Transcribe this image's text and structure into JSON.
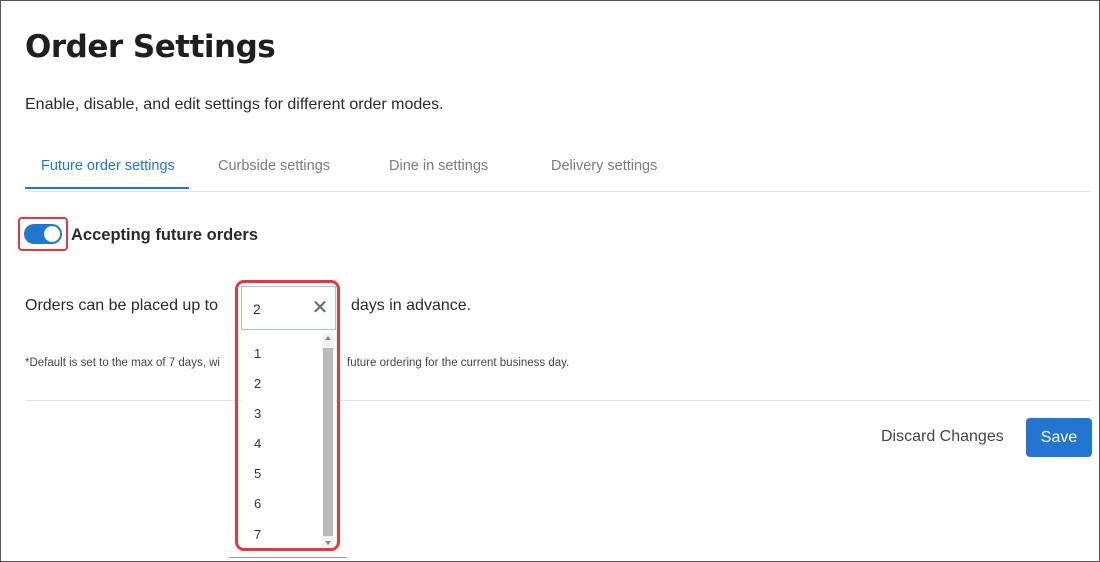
{
  "page": {
    "title": "Order Settings",
    "subtitle": "Enable, disable, and edit settings for different order modes."
  },
  "tabs": [
    {
      "label": "Future order settings",
      "active": true
    },
    {
      "label": "Curbside settings",
      "active": false
    },
    {
      "label": "Dine in settings",
      "active": false
    },
    {
      "label": "Delivery settings",
      "active": false
    }
  ],
  "future_orders": {
    "toggle_on": true,
    "toggle_label": "Accepting future orders",
    "orders_label": "Orders can be placed up to",
    "days_label": "days in advance.",
    "selected_days": "2",
    "clear_icon": "close-icon",
    "options": [
      "1",
      "2",
      "3",
      "4",
      "5",
      "6",
      "7"
    ],
    "note_start": "*Default is set to the max of 7 days, wi",
    "note_end": "future ordering for the current business day."
  },
  "actions": {
    "discard_label": "Discard Changes",
    "save_label": "Save"
  },
  "colors": {
    "accent": "#2276d2",
    "highlight": "#e2393c"
  }
}
